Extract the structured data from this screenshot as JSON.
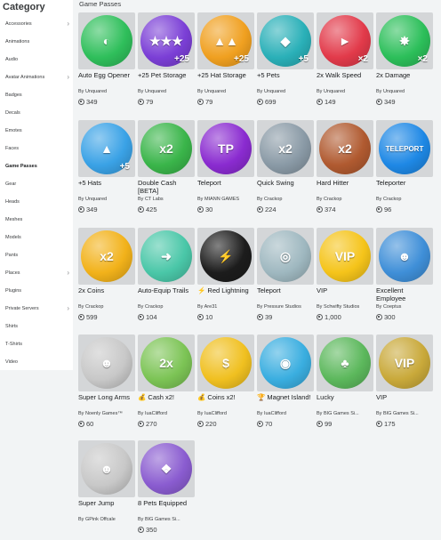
{
  "sidebar": {
    "title": "Category",
    "items": [
      {
        "label": "Accessories",
        "chevron": true
      },
      {
        "label": "Animations",
        "chevron": false
      },
      {
        "label": "Audio",
        "chevron": false
      },
      {
        "label": "Avatar Animations",
        "chevron": true
      },
      {
        "label": "Badges",
        "chevron": false
      },
      {
        "label": "Decals",
        "chevron": false
      },
      {
        "label": "Emotes",
        "chevron": false
      },
      {
        "label": "Faces",
        "chevron": false
      },
      {
        "label": "Game Passes",
        "chevron": false,
        "active": true
      },
      {
        "label": "Gear",
        "chevron": false
      },
      {
        "label": "Heads",
        "chevron": false
      },
      {
        "label": "Meshes",
        "chevron": false
      },
      {
        "label": "Models",
        "chevron": false
      },
      {
        "label": "Pants",
        "chevron": false
      },
      {
        "label": "Places",
        "chevron": true
      },
      {
        "label": "Plugins",
        "chevron": false
      },
      {
        "label": "Private Servers",
        "chevron": true
      },
      {
        "label": "Shirts",
        "chevron": false
      },
      {
        "label": "T-Shirts",
        "chevron": false
      },
      {
        "label": "Video",
        "chevron": false
      }
    ]
  },
  "main": {
    "section_title": "Game Passes",
    "items": [
      {
        "name": "Auto Egg Opener",
        "creator": "By Unquared",
        "price": "349",
        "color": "#2fbf5b",
        "glyph": "◐",
        "corner": ""
      },
      {
        "name": "+25 Pet Storage",
        "creator": "By Unquared",
        "price": "79",
        "color": "#7b3fd6",
        "glyph": "★★★",
        "corner": "+25"
      },
      {
        "name": "+25 Hat Storage",
        "creator": "By Unquared",
        "price": "79",
        "color": "#f0a020",
        "glyph": "▲▲",
        "corner": "+25"
      },
      {
        "name": "+5 Pets",
        "creator": "By Unquared",
        "price": "699",
        "color": "#2ab0b8",
        "glyph": "◆",
        "corner": "+5"
      },
      {
        "name": "2x Walk Speed",
        "creator": "By Unquared",
        "price": "149",
        "color": "#e23a4a",
        "glyph": "►",
        "corner": "×2"
      },
      {
        "name": "2x Damage",
        "creator": "By Unquared",
        "price": "349",
        "color": "#2cbf5a",
        "glyph": "✸",
        "corner": "×2"
      },
      {
        "name": "+5 Hats",
        "creator": "By Unquared",
        "price": "349",
        "color": "#3aa2e6",
        "glyph": "▲",
        "corner": "+5"
      },
      {
        "name": "Double Cash [BETA]",
        "creator": "By CT Labs",
        "price": "425",
        "color": "#3ab54a",
        "glyph": "x2",
        "corner": ""
      },
      {
        "name": "Teleport",
        "creator": "By MIANN GAMES",
        "price": "30",
        "color": "#8a2bd0",
        "glyph": "TP",
        "corner": ""
      },
      {
        "name": "Quick Swing",
        "creator": "By Crackop",
        "price": "224",
        "color": "#8a9aa6",
        "glyph": "x2",
        "corner": ""
      },
      {
        "name": "Hard Hitter",
        "creator": "By Crackop",
        "price": "374",
        "color": "#b05a30",
        "glyph": "x2",
        "corner": ""
      },
      {
        "name": "Teleporter",
        "creator": "By Crackop",
        "price": "96",
        "color": "#1e88e5",
        "glyph": "TELEPORT",
        "corner": ""
      },
      {
        "name": "2x Coins",
        "creator": "By Crackop",
        "price": "599",
        "color": "#f2b21a",
        "glyph": "x2",
        "corner": ""
      },
      {
        "name": "Auto-Equip Trails",
        "creator": "By Crackop",
        "price": "104",
        "color": "#4ac7a8",
        "glyph": "➜",
        "corner": ""
      },
      {
        "name": "⚡ Red Lightning",
        "creator": "By Are31",
        "price": "10",
        "color": "#1c1c1c",
        "glyph": "⚡",
        "corner": ""
      },
      {
        "name": "Teleport",
        "creator": "By Pressure Studios",
        "price": "39",
        "color": "#9fb8c0",
        "glyph": "◎",
        "corner": ""
      },
      {
        "name": "VIP",
        "creator": "By Schwifty Studios",
        "price": "1,000",
        "color": "#f5c41a",
        "glyph": "VIP",
        "corner": ""
      },
      {
        "name": "Excellent Employee",
        "creator": "By Coeptus",
        "price": "300",
        "color": "#3f8fd8",
        "glyph": "☻",
        "corner": ""
      },
      {
        "name": "Super Long Arms",
        "creator": "By Noenly Games™",
        "price": "60",
        "color": "#c8c8c8",
        "glyph": "☻",
        "corner": ""
      },
      {
        "name": "💰 Cash x2!",
        "creator": "By IuaClifford",
        "price": "270",
        "color": "#7cc455",
        "glyph": "2x",
        "corner": ""
      },
      {
        "name": "💰 Coins x2!",
        "creator": "By IuaClifford",
        "price": "220",
        "color": "#f0c020",
        "glyph": "$",
        "corner": ""
      },
      {
        "name": "🏆 Magnet Island!",
        "creator": "By IuaClifford",
        "price": "70",
        "color": "#3aaee0",
        "glyph": "◉",
        "corner": ""
      },
      {
        "name": "Lucky",
        "creator": "By BIG Games Si...",
        "price": "99",
        "color": "#5cb85c",
        "glyph": "♣",
        "corner": ""
      },
      {
        "name": "VIP",
        "creator": "By BIG Games Si...",
        "price": "175",
        "color": "#c9a93a",
        "glyph": "VIP",
        "corner": ""
      },
      {
        "name": "Super Jump",
        "creator": "By GPink Offcale",
        "price": "",
        "color": "#c8c8c8",
        "glyph": "☻",
        "corner": ""
      },
      {
        "name": "8 Pets Equipped",
        "creator": "By BIG Games Si...",
        "price": "350",
        "color": "#8a5cd0",
        "glyph": "❖",
        "corner": ""
      }
    ]
  }
}
